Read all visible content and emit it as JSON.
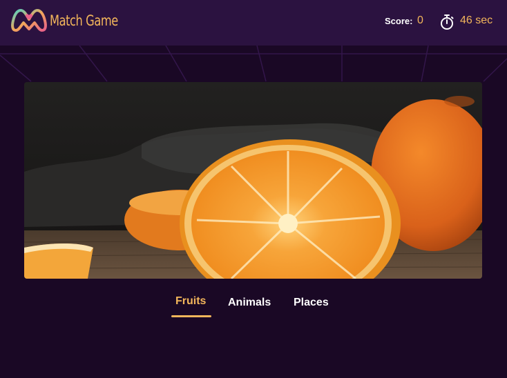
{
  "header": {
    "brand": "Match Game",
    "score_label": "Score:",
    "score_value": "0",
    "timer_value": "46 sec"
  },
  "hero": {
    "subject": "orange-halves-photo"
  },
  "tabs": [
    {
      "label": "Fruits",
      "active": true
    },
    {
      "label": "Animals",
      "active": false
    },
    {
      "label": "Places",
      "active": false
    }
  ],
  "colors": {
    "accent": "#f3b65b",
    "header_bg": "#2b1240",
    "page_bg": "#1a0825"
  }
}
